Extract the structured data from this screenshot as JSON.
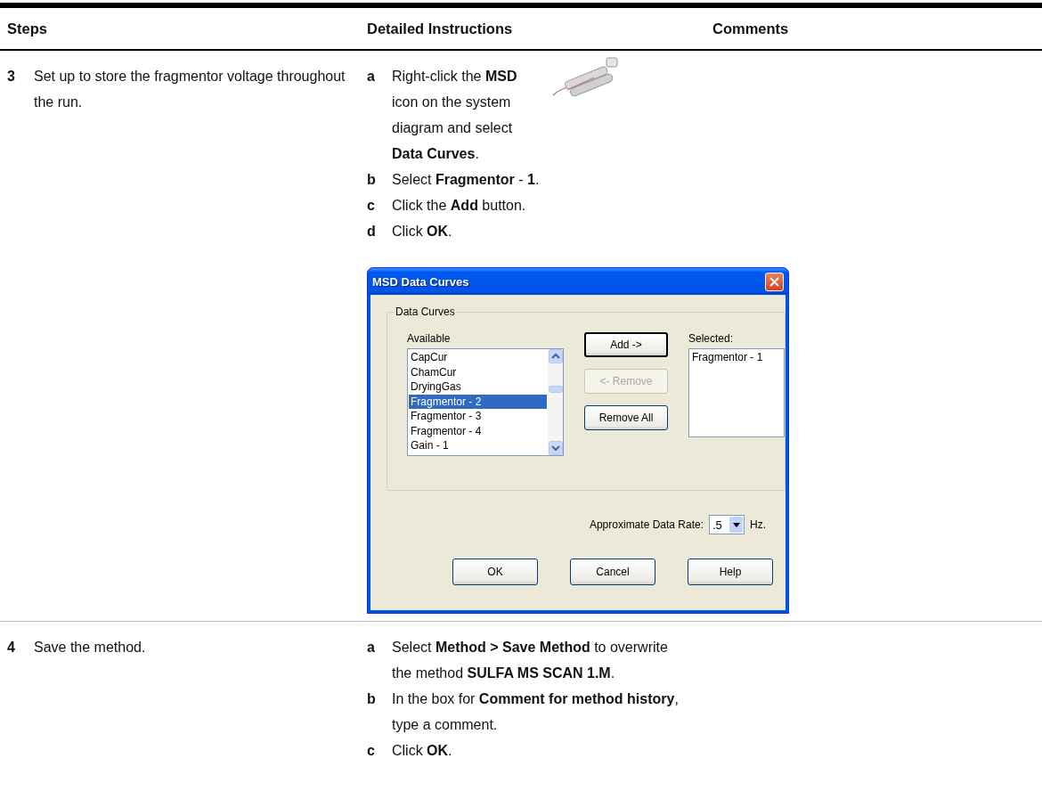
{
  "columns": [
    {
      "label": "Steps"
    },
    {
      "label": "Detailed Instructions"
    },
    {
      "label": "Comments"
    }
  ],
  "steps": [
    {
      "number": "3",
      "text": "Set up to store the fragmentor voltage throughout the run.",
      "instructions": [
        {
          "letter": "a",
          "text": "Right-click the **MSD** icon on the system diagram and select **Data Curves**.",
          "illustration": true
        },
        {
          "letter": "b",
          "text": "Select **Fragmentor** - **1**."
        },
        {
          "letter": "c",
          "text": "Click the **Add** button."
        },
        {
          "letter": "d",
          "text": "Click **OK**."
        }
      ],
      "dialog": {
        "title": "MSD Data Curves",
        "group_label": "Data Curves",
        "available_label": "Available",
        "available": [
          {
            "label": "CapCur",
            "selected": false
          },
          {
            "label": "ChamCur",
            "selected": false
          },
          {
            "label": "DryingGas",
            "selected": false
          },
          {
            "label": "Fragmentor - 2",
            "selected": true
          },
          {
            "label": "Fragmentor - 3",
            "selected": false
          },
          {
            "label": "Fragmentor - 4",
            "selected": false
          },
          {
            "label": "Gain - 1",
            "selected": false
          }
        ],
        "selected_label": "Selected:",
        "selected_items": [
          {
            "label": "Fragmentor - 1",
            "selected": false
          }
        ],
        "buttons": [
          {
            "label": "Add ->",
            "disabled": false,
            "focused": true
          },
          {
            "label": "<- Remove",
            "disabled": true,
            "focused": false
          },
          {
            "label": "Remove All",
            "disabled": false,
            "focused": false
          }
        ],
        "rate_label": "Approximate Data Rate:",
        "rate_value": ".5",
        "rate_unit": "Hz.",
        "footer_buttons": [
          {
            "label": "OK"
          },
          {
            "label": "Cancel"
          },
          {
            "label": "Help"
          }
        ]
      }
    },
    {
      "number": "4",
      "text": "Save the method.",
      "instructions": [
        {
          "letter": "a",
          "text": "Select **Method > Save Method** to overwrite the method **SULFA MS SCAN 1.M**."
        },
        {
          "letter": "b",
          "text": "In the box for **Comment for method history**, type a comment."
        },
        {
          "letter": "c",
          "text": "Click **OK**."
        }
      ]
    }
  ]
}
